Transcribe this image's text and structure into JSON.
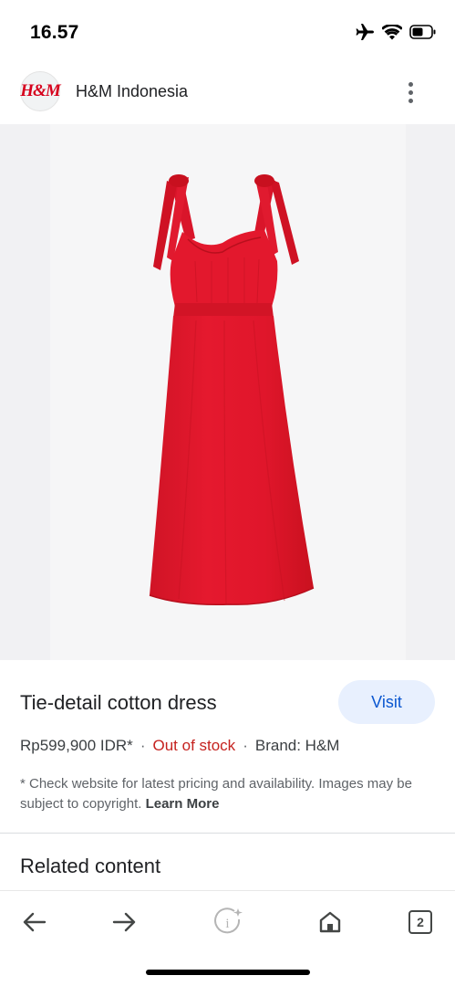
{
  "status_bar": {
    "time": "16.57",
    "icons": [
      "airplane-icon",
      "wifi-icon",
      "battery-icon"
    ]
  },
  "site": {
    "logo_text": "H&M",
    "name": "H&M Indonesia",
    "menu_icon": "more-vert-icon"
  },
  "product": {
    "image_description_icon": "red-dress-image",
    "title": "Tie-detail cotton dress",
    "visit_label": "Visit",
    "price": "Rp599,900 IDR*",
    "stock_status": "Out of stock",
    "brand": "Brand: H&M",
    "separator": "·",
    "disclaimer": "* Check website for latest pricing and availability. Images may be subject to copyright.",
    "learn_more": "Learn More"
  },
  "related": {
    "title": "Related content"
  },
  "toolbar": {
    "tab_count": "2",
    "icons": [
      "back-arrow-icon",
      "forward-arrow-icon",
      "lens-info-icon",
      "home-icon",
      "tabs-icon"
    ]
  },
  "colors": {
    "dress_red": "#e0162b",
    "stock_red": "#c5221f",
    "visit_bg": "#e8f0fe",
    "visit_text": "#0b57d0"
  }
}
